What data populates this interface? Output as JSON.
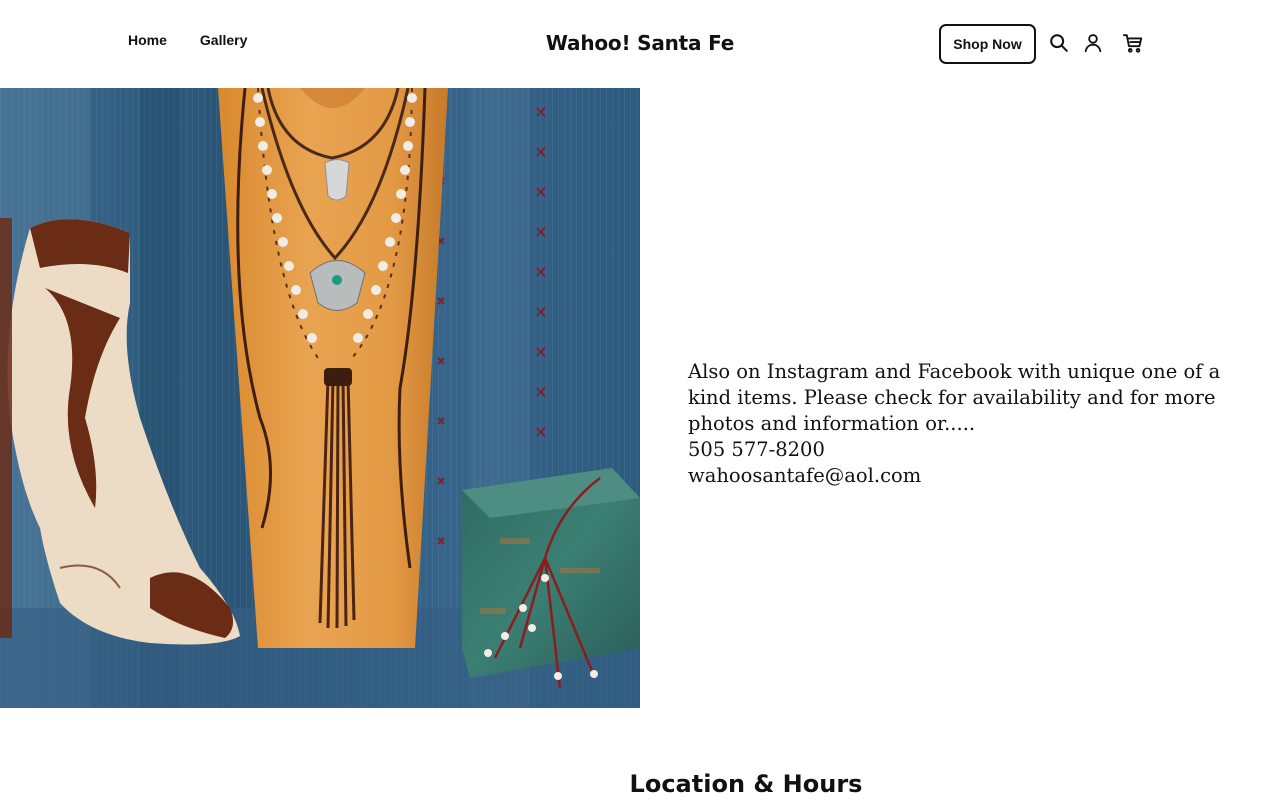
{
  "header": {
    "nav": {
      "home": "Home",
      "gallery": "Gallery"
    },
    "brand": "Wahoo! Santa Fe",
    "shop_button": "Shop Now",
    "icons": [
      "search-icon",
      "account-icon",
      "cart-icon"
    ]
  },
  "hero": {
    "image_label": "Cowboy boot, pearl and leather fringe necklaces on wooden bust, turquoise box over indigo denim",
    "lines": [
      "Also on Instagram and Facebook with unique one of a kind items. Please check for availability and for more photos and information or.....",
      "505 577-8200",
      "wahoosantafe@aol.com"
    ]
  },
  "location": {
    "title": "Location & Hours"
  },
  "colors": {
    "text": "#111111",
    "background": "#ffffff",
    "denim": "#2d5a80"
  }
}
